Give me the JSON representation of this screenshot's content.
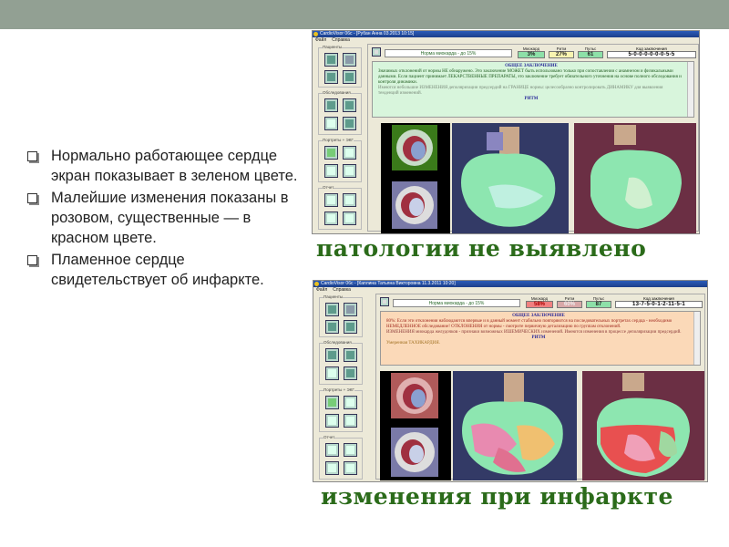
{
  "slide": {
    "bullets": [
      "Нормально работающее сердце экран показывает в зеленом цвете.",
      "Малейшие изменения показаны в розовом, существенные — в красном цвете.",
      " Пламенное сердце свидетельствует об инфаркте."
    ],
    "colors": {
      "band": "#92a093",
      "caption": "#2b6b1a"
    }
  },
  "window1": {
    "title": "CardioVisor 06с - [Рубан Анна 03.2013 10:15]",
    "menu": [
      "Файл",
      "Справка"
    ],
    "groups": [
      "Пациенты",
      "Обследования",
      "Портреты + ЭКГ",
      "Отчет"
    ],
    "norm": "Норма миокарда - до 15%",
    "indicators": [
      {
        "label": "Миокард",
        "value": "3%",
        "color": "#8de0a8"
      },
      {
        "label": "Ритм",
        "value": "27%",
        "color": "#f8f4b0"
      },
      {
        "label": "Пульс",
        "value": "61",
        "color": "#8de0a8"
      }
    ],
    "code_label": "Код заключения",
    "code": "5-0-0-0-0-0-0-5-5",
    "conclusion_title": "ОБЩЕЕ ЗАКЛЮЧЕНИЕ",
    "conclusion_text": "Значимых отклонений от нормы НЕ обнаружено. Это заключение МОЖЕТ быть использовано только при сопоставлении с анамнезом и физикальными данными. Если пациент принимает ЛЕКАРСТВЕННЫЕ ПРЕПАРАТЫ, это заключение требует обязательного уточнения на основе полного обследования и контроля динамики.",
    "conclusion_note": "Имеются небольшие ИЗМЕНЕНИЯ деполяризации предсердий на ГРАНИЦЕ нормы: целесообразно контролировать ДИНАМИКУ для выявления тенденций изменений.",
    "rhythm_title": "РИТМ",
    "caption": "патологии не выявлено"
  },
  "window2": {
    "title": "CardioVisor 06с - [Каплина Татьяна Викторовна 11.3.2011 10:20]",
    "menu": [
      "Файл",
      "Справка"
    ],
    "groups": [
      "Пациенты",
      "Обследования",
      "Портреты + ЭКГ",
      "Отчет"
    ],
    "norm": "Норма миокарда - до 15%",
    "indicators": [
      {
        "label": "Миокард",
        "value": "58%",
        "color": "#f08080"
      },
      {
        "label": "Ритм",
        "value": "60%",
        "color": "#d8a8a8"
      },
      {
        "label": "Пульс",
        "value": "87",
        "color": "#8de0a8"
      }
    ],
    "code_label": "Код заключения",
    "code": "13-7-5-0-1-2-11-5-1",
    "conclusion_title": "ОБЩЕЕ ЗАКЛЮЧЕНИЕ",
    "conclusion_text": "80%: Если эти отклонения наблюдаются впервые и в данный момент стабильно повторяются на последовательных портретах сердца - необходимо НЕМЕДЛЕННОЕ обследование! ОТКЛОНЕНИЯ от нормы - смотрите первичную детализацию по группам отклонений.",
    "conclusion_note": "ИЗМЕНЕНИЯ миокарда желудочков - признаки возможных ИШЕМИЧЕСКИХ изменений. Имеются изменения в процессе деполяризации предсердий.",
    "rhythm_title": "РИТМ",
    "rhythm_text": "Умеренная ТАХИКАРДИЯ.",
    "caption": "изменения при инфаркте"
  }
}
